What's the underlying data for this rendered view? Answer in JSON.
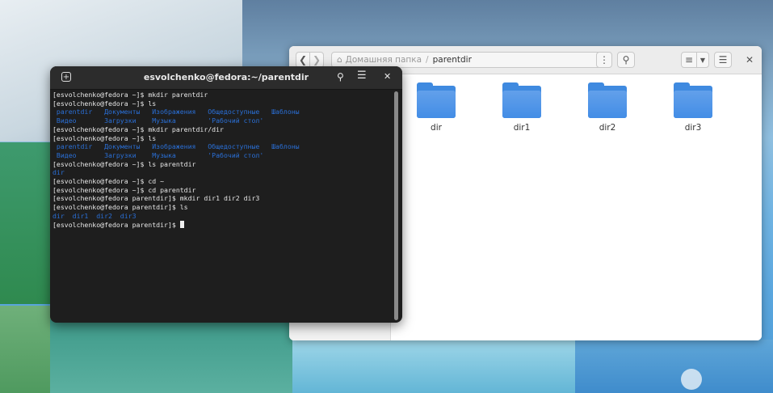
{
  "terminal": {
    "title": "esvolchenko@fedora:~/parentdir",
    "lines": [
      {
        "prompt": "[esvolchenko@fedora ~]$ ",
        "cmd": "mkdir parentdir"
      },
      {
        "prompt": "[esvolchenko@fedora ~]$ ",
        "cmd": "ls"
      },
      {
        "dirs": " parentdir   Документы   Изображения   Общедоступные   Шаблоны"
      },
      {
        "dirs": " Видео       Загрузки    Музыка        'Рабочий стол'"
      },
      {
        "prompt": "[esvolchenko@fedora ~]$ ",
        "cmd": "mkdir parentdir/dir"
      },
      {
        "prompt": "[esvolchenko@fedora ~]$ ",
        "cmd": "ls"
      },
      {
        "dirs": " parentdir   Документы   Изображения   Общедоступные   Шаблоны"
      },
      {
        "dirs": " Видео       Загрузки    Музыка        'Рабочий стол'"
      },
      {
        "prompt": "[esvolchenko@fedora ~]$ ",
        "cmd": "ls parentdir"
      },
      {
        "dirs": "dir"
      },
      {
        "prompt": "[esvolchenko@fedora ~]$ ",
        "cmd": "cd ~"
      },
      {
        "prompt": "[esvolchenko@fedora ~]$ ",
        "cmd": "cd parentdir"
      },
      {
        "prompt": "[esvolchenko@fedora parentdir]$ ",
        "cmd": "mkdir dir1 dir2 dir3"
      },
      {
        "prompt": "[esvolchenko@fedora parentdir]$ ",
        "cmd": "ls"
      },
      {
        "dirs": "dir  dir1  dir2  dir3"
      },
      {
        "prompt": "[esvolchenko@fedora parentdir]$ ",
        "cmd": "",
        "cursor": true
      }
    ],
    "icons": {
      "new_tab": "new-tab-icon",
      "search": "search-icon",
      "menu": "hamburger-menu-icon",
      "close": "close-icon"
    }
  },
  "file_manager": {
    "breadcrumb_home": "Домашняя папка",
    "breadcrumb_current": "parentdir",
    "folders": [
      "dir",
      "dir1",
      "dir2",
      "dir3"
    ],
    "icons": {
      "back": "back-arrow-icon",
      "forward": "forward-arrow-icon",
      "home": "home-icon",
      "menu": "kebab-menu-icon",
      "search": "search-icon",
      "view": "list-view-icon",
      "view_dropdown": "chevron-down-icon",
      "list": "hamburger-menu-icon",
      "close": "close-icon"
    },
    "accent": "#3f8ae0"
  }
}
